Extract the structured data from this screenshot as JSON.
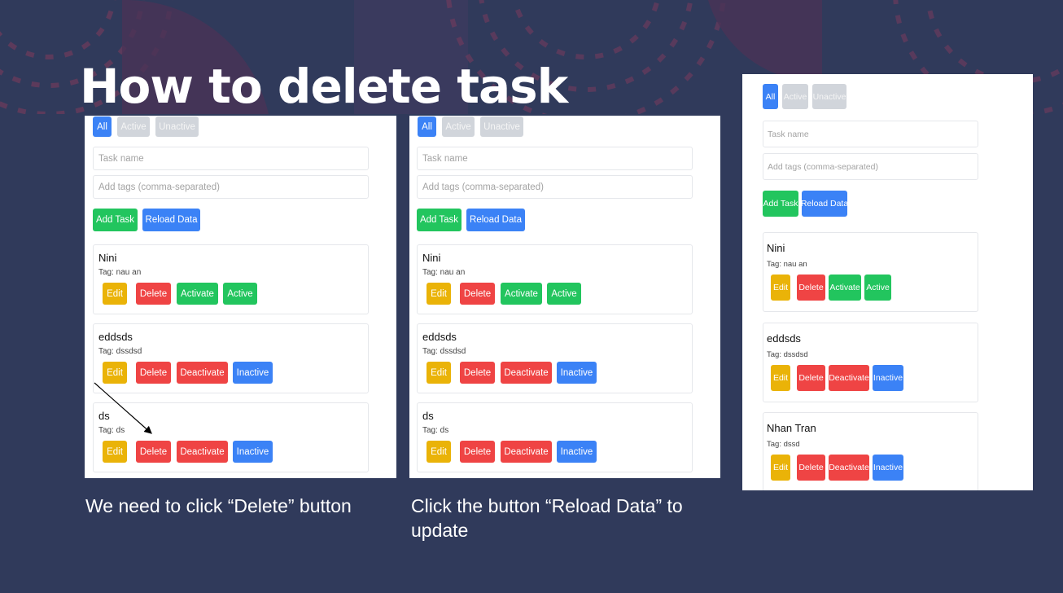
{
  "slide": {
    "title": "How to delete task",
    "caption_left": "We need to click “Delete” button",
    "caption_middle": "Click the button “Reload Data” to update"
  },
  "app": {
    "filters": [
      "All",
      "Active",
      "Unactive"
    ],
    "task_name_placeholder": "Task name",
    "tags_placeholder": "Add tags (comma-separated)",
    "add_task_label": "Add Task",
    "reload_label": "Reload Data",
    "edit_label": "Edit",
    "delete_label": "Delete"
  },
  "screens": [
    {
      "tasks": [
        {
          "name": "Nini",
          "tag": "Tag: nau an",
          "toggle": "Activate",
          "status": "Active"
        },
        {
          "name": "eddsds",
          "tag": "Tag: dssdsd",
          "toggle": "Deactivate",
          "status": "Inactive"
        },
        {
          "name": "ds",
          "tag": "Tag: ds",
          "toggle": "Deactivate",
          "status": "Inactive"
        }
      ]
    },
    {
      "tasks": [
        {
          "name": "Nini",
          "tag": "Tag: nau an",
          "toggle": "Activate",
          "status": "Active"
        },
        {
          "name": "eddsds",
          "tag": "Tag: dssdsd",
          "toggle": "Deactivate",
          "status": "Inactive"
        },
        {
          "name": "ds",
          "tag": "Tag: ds",
          "toggle": "Deactivate",
          "status": "Inactive"
        }
      ]
    },
    {
      "tasks": [
        {
          "name": "Nini",
          "tag": "Tag: nau an",
          "toggle": "Activate",
          "status": "Active"
        },
        {
          "name": "eddsds",
          "tag": "Tag: dssdsd",
          "toggle": "Deactivate",
          "status": "Inactive"
        },
        {
          "name": "Nhan Tran",
          "tag": "Tag: dssd",
          "toggle": "Deactivate",
          "status": "Inactive"
        }
      ]
    }
  ],
  "colors": {
    "background": "#303a5b",
    "primary": "#3b82f6",
    "success": "#22c55e",
    "danger": "#ef4444",
    "warning": "#eab308",
    "muted": "#d1d5db"
  }
}
